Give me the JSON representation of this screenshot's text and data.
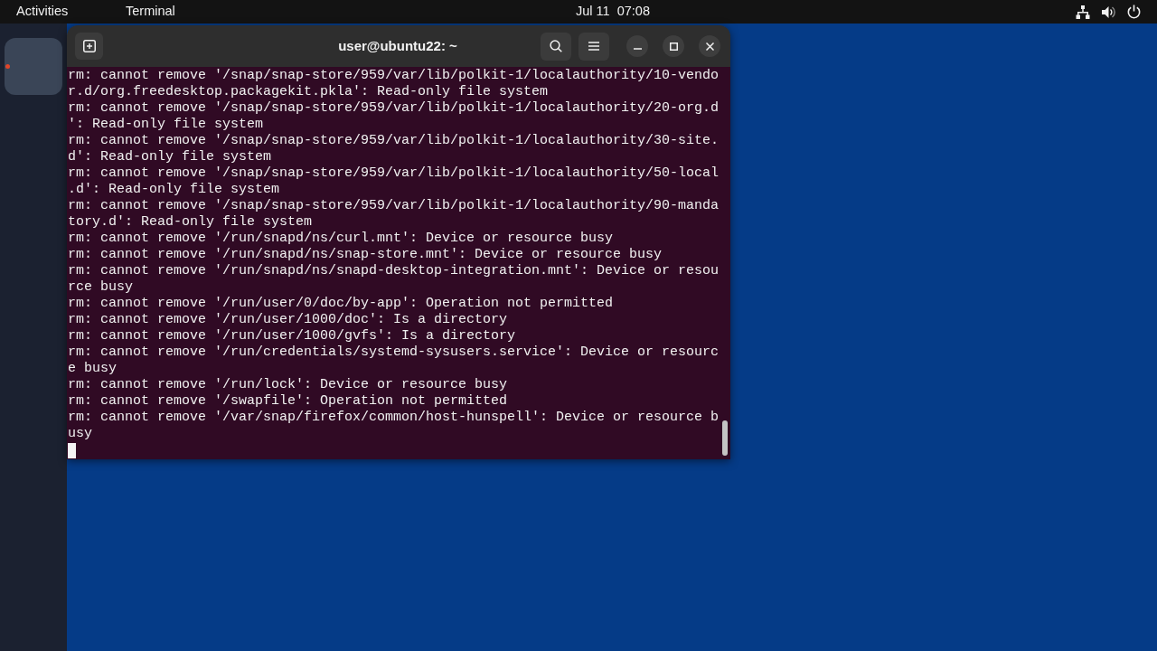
{
  "top_bar": {
    "activities": "Activities",
    "app_menu": "Terminal",
    "clock": "Jul 11  07:08"
  },
  "dock": {
    "items": [
      {
        "selected": true,
        "running": true
      }
    ]
  },
  "terminal": {
    "title": "user@ubuntu22: ~",
    "lines": [
      "rm: cannot remove '/snap/snap-store/959/var/lib/polkit-1/localauthority/10-vendo",
      "r.d/org.freedesktop.packagekit.pkla': Read-only file system",
      "rm: cannot remove '/snap/snap-store/959/var/lib/polkit-1/localauthority/20-org.d",
      "': Read-only file system",
      "rm: cannot remove '/snap/snap-store/959/var/lib/polkit-1/localauthority/30-site.",
      "d': Read-only file system",
      "rm: cannot remove '/snap/snap-store/959/var/lib/polkit-1/localauthority/50-local",
      ".d': Read-only file system",
      "rm: cannot remove '/snap/snap-store/959/var/lib/polkit-1/localauthority/90-manda",
      "tory.d': Read-only file system",
      "rm: cannot remove '/run/snapd/ns/curl.mnt': Device or resource busy",
      "rm: cannot remove '/run/snapd/ns/snap-store.mnt': Device or resource busy",
      "rm: cannot remove '/run/snapd/ns/snapd-desktop-integration.mnt': Device or resou",
      "rce busy",
      "rm: cannot remove '/run/user/0/doc/by-app': Operation not permitted",
      "rm: cannot remove '/run/user/1000/doc': Is a directory",
      "rm: cannot remove '/run/user/1000/gvfs': Is a directory",
      "rm: cannot remove '/run/credentials/systemd-sysusers.service': Device or resourc",
      "e busy",
      "rm: cannot remove '/run/lock': Device or resource busy",
      "rm: cannot remove '/swapfile': Operation not permitted",
      "rm: cannot remove '/var/snap/firefox/common/host-hunspell': Device or resource b",
      "usy"
    ]
  }
}
